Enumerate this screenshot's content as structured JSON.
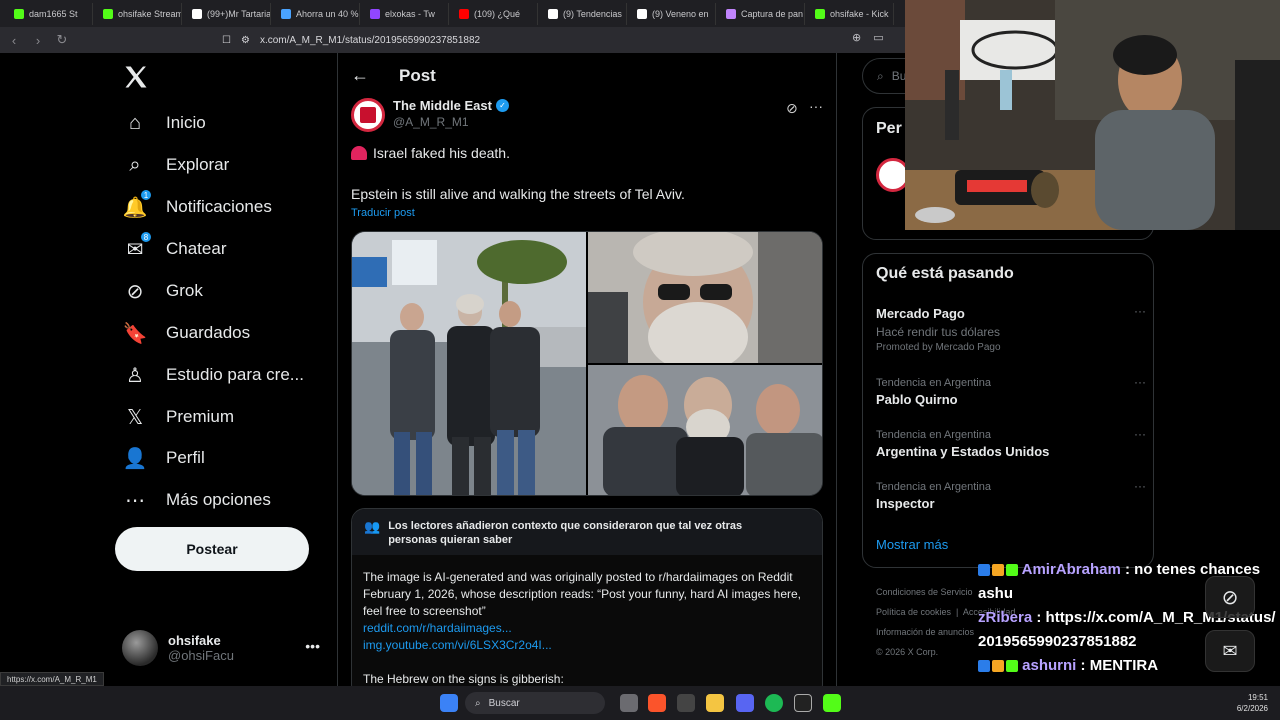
{
  "browser": {
    "tabs": [
      {
        "label": "dam1665 St",
        "color": "#53fc18"
      },
      {
        "label": "ohsifake Stream",
        "color": "#53fc18"
      },
      {
        "label": "(99+)Mr Tartaria",
        "color": "#ffffff"
      },
      {
        "label": "Ahorra un 40 %",
        "color": "#4aa3ff"
      },
      {
        "label": "elxokas - Tw",
        "color": "#9146ff"
      },
      {
        "label": "(109) ¿Qué",
        "color": "#ff0000"
      },
      {
        "label": "(9) Tendencias",
        "color": "#ffffff"
      },
      {
        "label": "(9) Veneno en",
        "color": "#ffffff"
      },
      {
        "label": "Captura de pan",
        "color": "#c084fc"
      },
      {
        "label": "ohsifake - Kick",
        "color": "#53fc18"
      }
    ],
    "url": "x.com/A_M_R_M1/status/2019565990237851882",
    "status_url": "https://x.com/A_M_R_M1"
  },
  "nav": {
    "items": [
      {
        "label": "Inicio",
        "icon": "home-icon"
      },
      {
        "label": "Explorar",
        "icon": "search-icon"
      },
      {
        "label": "Notificaciones",
        "icon": "bell-icon",
        "badge": "1"
      },
      {
        "label": "Chatear",
        "icon": "mail-icon",
        "badge": "8"
      },
      {
        "label": "Grok",
        "icon": "grok-icon"
      },
      {
        "label": "Guardados",
        "icon": "bookmark-icon"
      },
      {
        "label": "Estudio para cre...",
        "icon": "studio-icon"
      },
      {
        "label": "Premium",
        "icon": "x-icon"
      },
      {
        "label": "Perfil",
        "icon": "person-icon"
      },
      {
        "label": "Más opciones",
        "icon": "more-circle-icon"
      }
    ],
    "post_button": "Postear",
    "profile": {
      "name": "ohsifake",
      "handle": "@ohsiFacu"
    }
  },
  "post": {
    "header_title": "Post",
    "author_name": "The Middle East",
    "author_handle": "@A_M_R_M1",
    "line1": "Israel faked his death.",
    "line2": "Epstein is still alive and walking the streets of Tel Aviv.",
    "translate": "Traducir post",
    "note": {
      "title": "Los lectores añadieron contexto que consideraron que tal vez otras personas quieran saber",
      "body": "The image is AI-generated and was originally posted to r/hardaiimages on Reddit February 1, 2026, whose description reads: “Post your funny, hard AI images here, feel free to screenshot”",
      "link1": "reddit.com/r/hardaiimages...",
      "link2": "img.youtube.com/vi/6LSX3Cr2o4I...",
      "body2": "The Hebrew on the signs is gibberish:"
    }
  },
  "right": {
    "search_placeholder": "Bu",
    "card_title": "Per",
    "trends_title": "Qué está pasando",
    "trends": [
      {
        "name": "Mercado Pago",
        "desc": "Hacé rendir tus dólares",
        "promo": "Promoted by Mercado Pago"
      },
      {
        "meta": "Tendencia en Argentina",
        "name": "Pablo Quirno"
      },
      {
        "meta": "Tendencia en Argentina",
        "name": "Argentina y Estados Unidos"
      },
      {
        "meta": "Tendencia en Argentina",
        "name": "Inspector"
      }
    ],
    "show_more": "Mostrar más",
    "footer": {
      "line1": "Condiciones de Servicio",
      "line2": "Política de cookies",
      "line2b": "Accesibilidad",
      "line3": "Información de anuncios",
      "line4": "© 2026 X Corp."
    }
  },
  "chat": [
    {
      "user": "AmirAbraham",
      "message": "no tenes chances ashu"
    },
    {
      "user": "zRibera",
      "message": "https://x.com/A_M_R_M1/status/2019565990237851882"
    },
    {
      "user": "ashurni",
      "message": "MENTIRA"
    }
  ],
  "taskbar": {
    "search": "Buscar",
    "time": "19:51",
    "date": "6/2/2026"
  }
}
